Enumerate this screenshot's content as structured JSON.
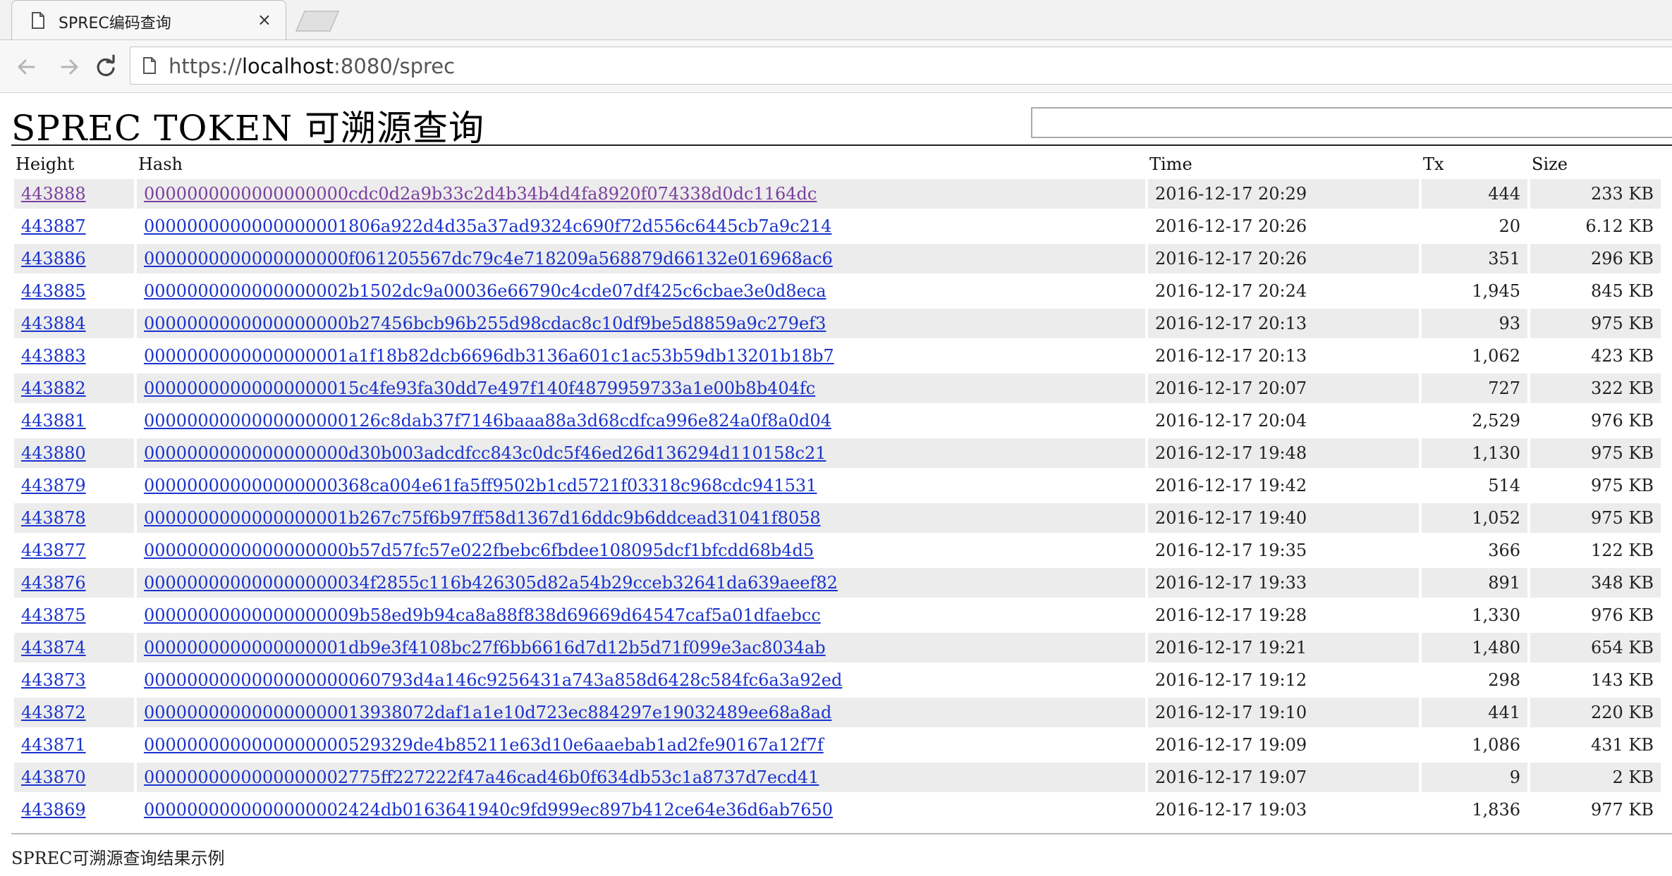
{
  "browser": {
    "tab_title": "SPREC编码查询",
    "tab_close": "×",
    "url_scheme": "https://",
    "url_host": "localhost",
    "url_rest": ":8080/sprec"
  },
  "page": {
    "title": "SPREC TOKEN 可溯源查询",
    "search_placeholder": "",
    "caption": "SPREC可溯源查询结果示例"
  },
  "table": {
    "headers": {
      "height": "Height",
      "hash": "Hash",
      "time": "Time",
      "tx": "Tx",
      "size": "Size"
    },
    "rows": [
      {
        "height": "443888",
        "hash": "0000000000000000000cdc0d2a9b33c2d4b34b4d4fa8920f074338d0dc1164dc",
        "time": "2016-12-17 20:29",
        "tx": "444",
        "size": "233 KB"
      },
      {
        "height": "443887",
        "hash": "0000000000000000001806a922d4d35a37ad9324c690f72d556c6445cb7a9c214",
        "time": "2016-12-17 20:26",
        "tx": "20",
        "size": "6.12 KB"
      },
      {
        "height": "443886",
        "hash": "0000000000000000000f061205567dc79c4e718209a568879d66132e016968ac6",
        "time": "2016-12-17 20:26",
        "tx": "351",
        "size": "296 KB"
      },
      {
        "height": "443885",
        "hash": "0000000000000000002b1502dc9a00036e66790c4cde07df425c6cbae3e0d8eca",
        "time": "2016-12-17 20:24",
        "tx": "1,945",
        "size": "845 KB"
      },
      {
        "height": "443884",
        "hash": "0000000000000000000b27456bcb96b255d98cdac8c10df9be5d8859a9c279ef3",
        "time": "2016-12-17 20:13",
        "tx": "93",
        "size": "975 KB"
      },
      {
        "height": "443883",
        "hash": "0000000000000000001a1f18b82dcb6696db3136a601c1ac53b59db13201b18b7",
        "time": "2016-12-17 20:13",
        "tx": "1,062",
        "size": "423 KB"
      },
      {
        "height": "443882",
        "hash": "00000000000000000015c4fe93fa30dd7e497f140f4879959733a1e00b8b404fc",
        "time": "2016-12-17 20:07",
        "tx": "727",
        "size": "322 KB"
      },
      {
        "height": "443881",
        "hash": "0000000000000000000126c8dab37f7146baaa88a3d68cdfca996e824a0f8a0d04",
        "time": "2016-12-17 20:04",
        "tx": "2,529",
        "size": "976 KB"
      },
      {
        "height": "443880",
        "hash": "0000000000000000000d30b003adcdfcc843c0dc5f46ed26d136294d110158c21",
        "time": "2016-12-17 19:48",
        "tx": "1,130",
        "size": "975 KB"
      },
      {
        "height": "443879",
        "hash": "000000000000000000368ca004e61fa5ff9502b1cd5721f03318c968cdc941531",
        "time": "2016-12-17 19:42",
        "tx": "514",
        "size": "975 KB"
      },
      {
        "height": "443878",
        "hash": "0000000000000000001b267c75f6b97ff58d1367d16ddc9b6ddcead31041f8058",
        "time": "2016-12-17 19:40",
        "tx": "1,052",
        "size": "975 KB"
      },
      {
        "height": "443877",
        "hash": "0000000000000000000b57d57fc57e022fbebc6fbdee108095dcf1bfcdd68b4d5",
        "time": "2016-12-17 19:35",
        "tx": "366",
        "size": "122 KB"
      },
      {
        "height": "443876",
        "hash": "000000000000000000034f2855c116b426305d82a54b29cceb32641da639aeef82",
        "time": "2016-12-17 19:33",
        "tx": "891",
        "size": "348 KB"
      },
      {
        "height": "443875",
        "hash": "00000000000000000009b58ed9b94ca8a88f838d69669d64547caf5a01dfaebcc",
        "time": "2016-12-17 19:28",
        "tx": "1,330",
        "size": "976 KB"
      },
      {
        "height": "443874",
        "hash": "0000000000000000001db9e3f4108bc27f6bb6616d7d12b5d71f099e3ac8034ab",
        "time": "2016-12-17 19:21",
        "tx": "1,480",
        "size": "654 KB"
      },
      {
        "height": "443873",
        "hash": "0000000000000000000060793d4a146c9256431a743a858d6428c584fc6a3a92ed",
        "time": "2016-12-17 19:12",
        "tx": "298",
        "size": "143 KB"
      },
      {
        "height": "443872",
        "hash": "000000000000000000013938072daf1a1e10d723ec884297e19032489ee68a8ad",
        "time": "2016-12-17 19:10",
        "tx": "441",
        "size": "220 KB"
      },
      {
        "height": "443871",
        "hash": "0000000000000000000529329de4b85211e63d10e6aaebab1ad2fe90167a12f7f",
        "time": "2016-12-17 19:09",
        "tx": "1,086",
        "size": "431 KB"
      },
      {
        "height": "443870",
        "hash": "0000000000000000002775ff227222f47a46cad46b0f634db53c1a8737d7ecd41",
        "time": "2016-12-17 19:07",
        "tx": "9",
        "size": "2 KB"
      },
      {
        "height": "443869",
        "hash": "0000000000000000002424db0163641940c9fd999ec897b412ce64e36d6ab7650",
        "time": "2016-12-17 19:03",
        "tx": "1,836",
        "size": "977 KB"
      }
    ]
  },
  "colors": {
    "link": "#1a33cc",
    "visited_link": "#7b3f9e",
    "row_stripe": "#ececec"
  },
  "icons": [
    "page-icon",
    "close-icon",
    "back-arrow-icon",
    "forward-arrow-icon",
    "reload-icon"
  ]
}
